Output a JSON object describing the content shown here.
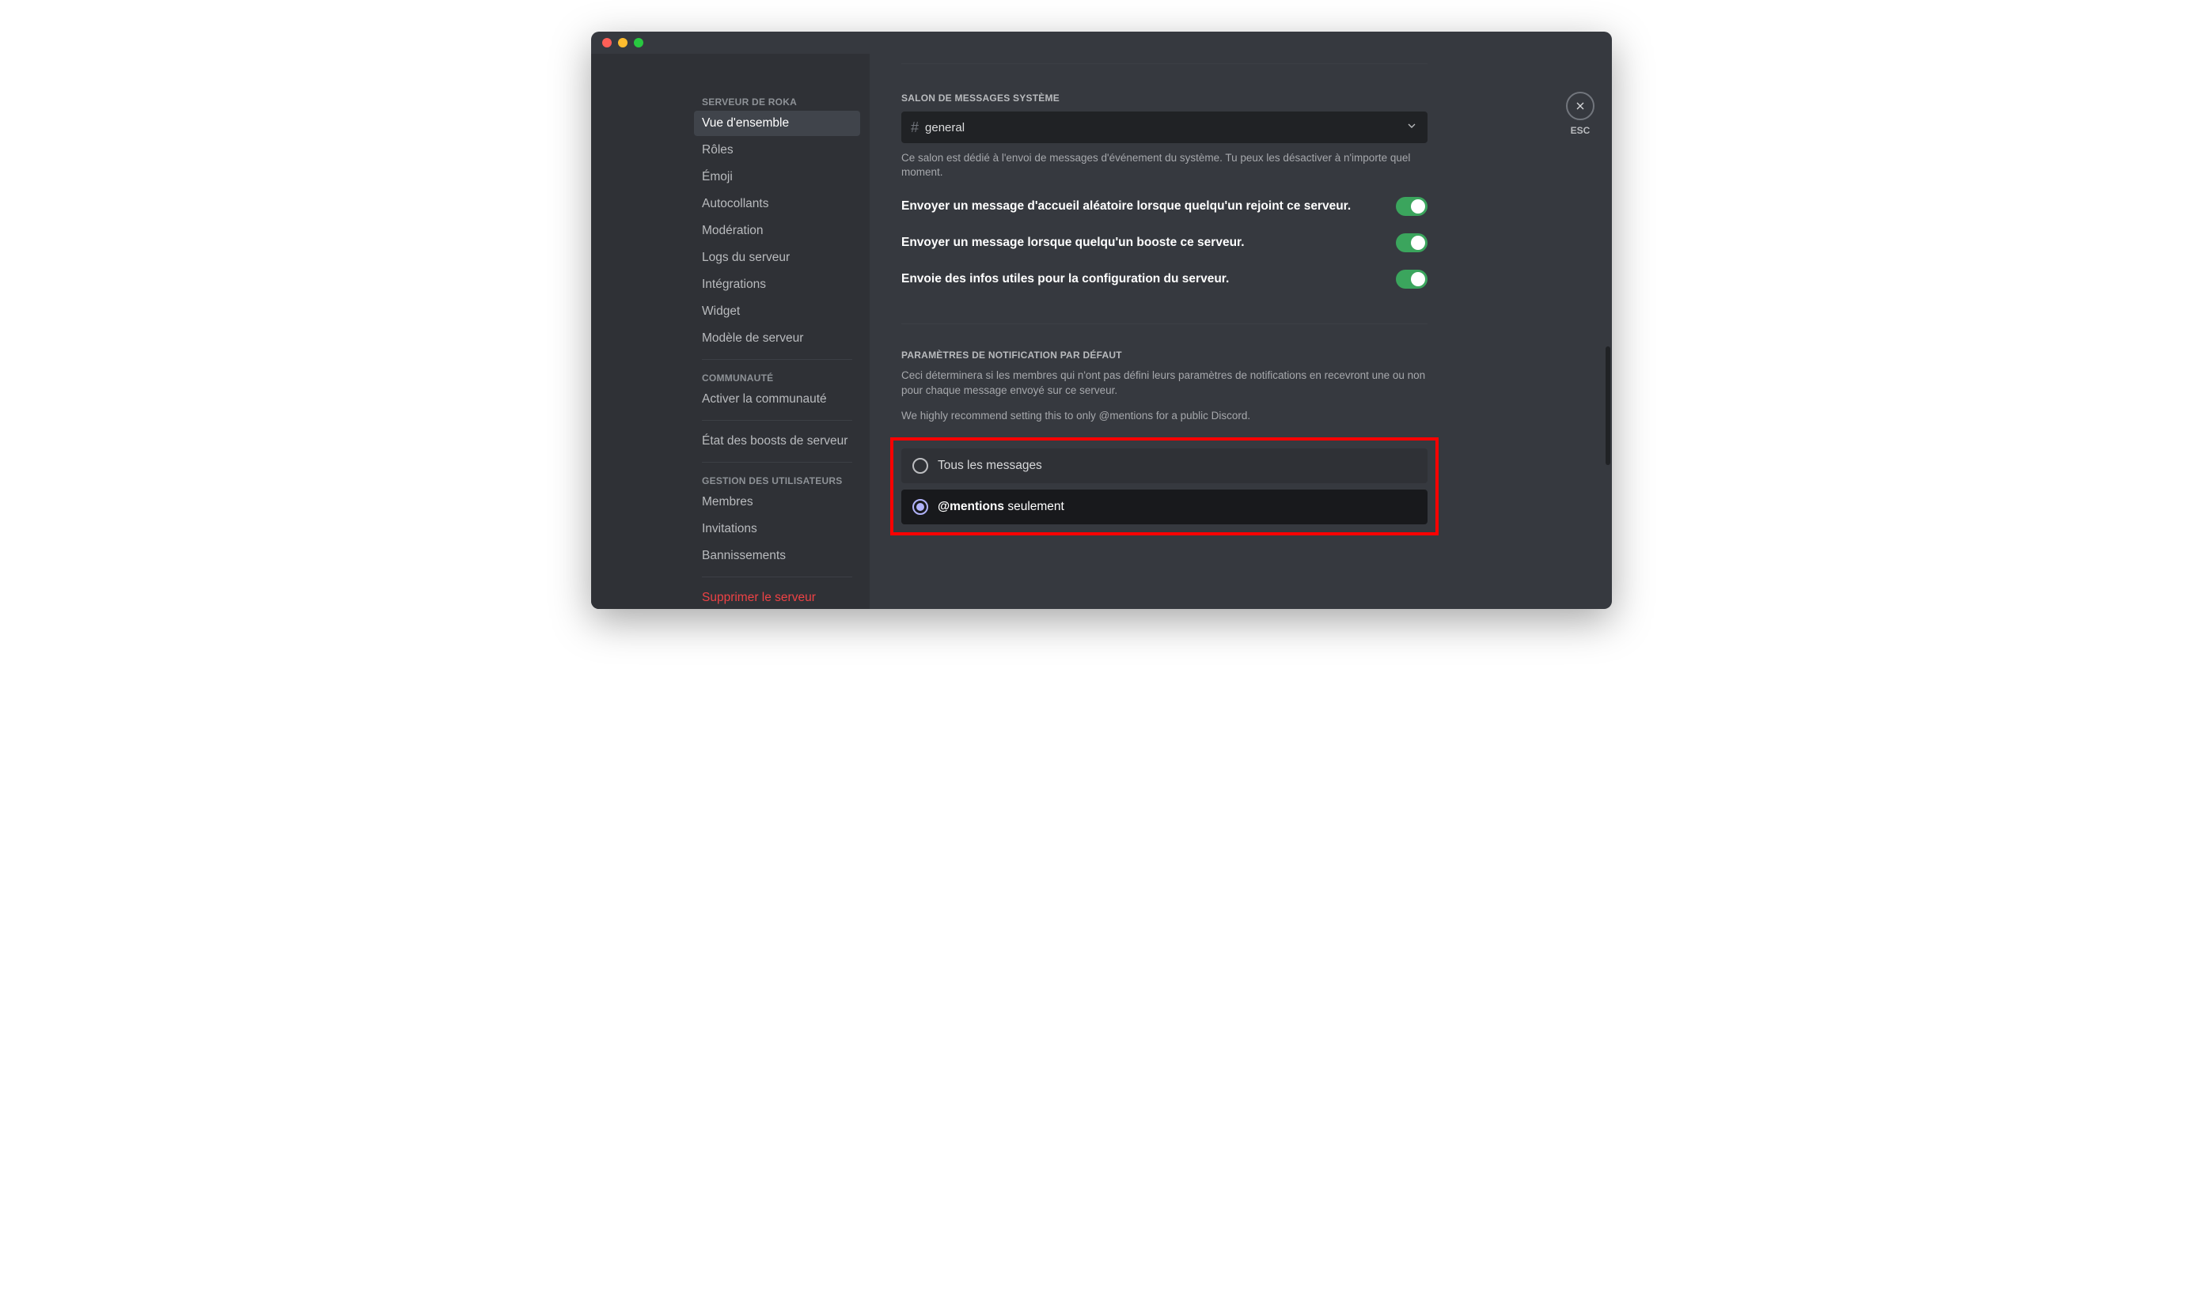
{
  "sidebar": {
    "header1": "SERVEUR DE ROKA",
    "items1": [
      "Vue d'ensemble",
      "Rôles",
      "Émoji",
      "Autocollants",
      "Modération",
      "Logs du serveur",
      "Intégrations",
      "Widget",
      "Modèle de serveur"
    ],
    "header2": "COMMUNAUTÉ",
    "items2": [
      "Activer la communauté"
    ],
    "items2b": [
      "État des boosts de serveur"
    ],
    "header3": "GESTION DES UTILISATEURS",
    "items3": [
      "Membres",
      "Invitations",
      "Bannissements"
    ],
    "delete": "Supprimer le serveur"
  },
  "content": {
    "sysHeader": "SALON DE MESSAGES SYSTÈME",
    "channel": "general",
    "sysDesc": "Ce salon est dédié à l'envoi de messages d'événement du système. Tu peux les désactiver à n'importe quel moment.",
    "tog1": "Envoyer un message d'accueil aléatoire lorsque quelqu'un rejoint ce serveur.",
    "tog2": "Envoyer un message lorsque quelqu'un booste ce serveur.",
    "tog3": "Envoie des infos utiles pour la configuration du serveur.",
    "notifHeader": "PARAMÈTRES DE NOTIFICATION PAR DÉFAUT",
    "notifDesc1": "Ceci déterminera si les membres qui n'ont pas défini leurs paramètres de notifications en recevront une ou non pour chaque message envoyé sur ce serveur.",
    "notifDesc2": "We highly recommend setting this to only @mentions for a public Discord.",
    "radio1": "Tous les messages",
    "radio2a": "@mentions",
    "radio2b": " seulement"
  },
  "close": {
    "label": "ESC"
  }
}
